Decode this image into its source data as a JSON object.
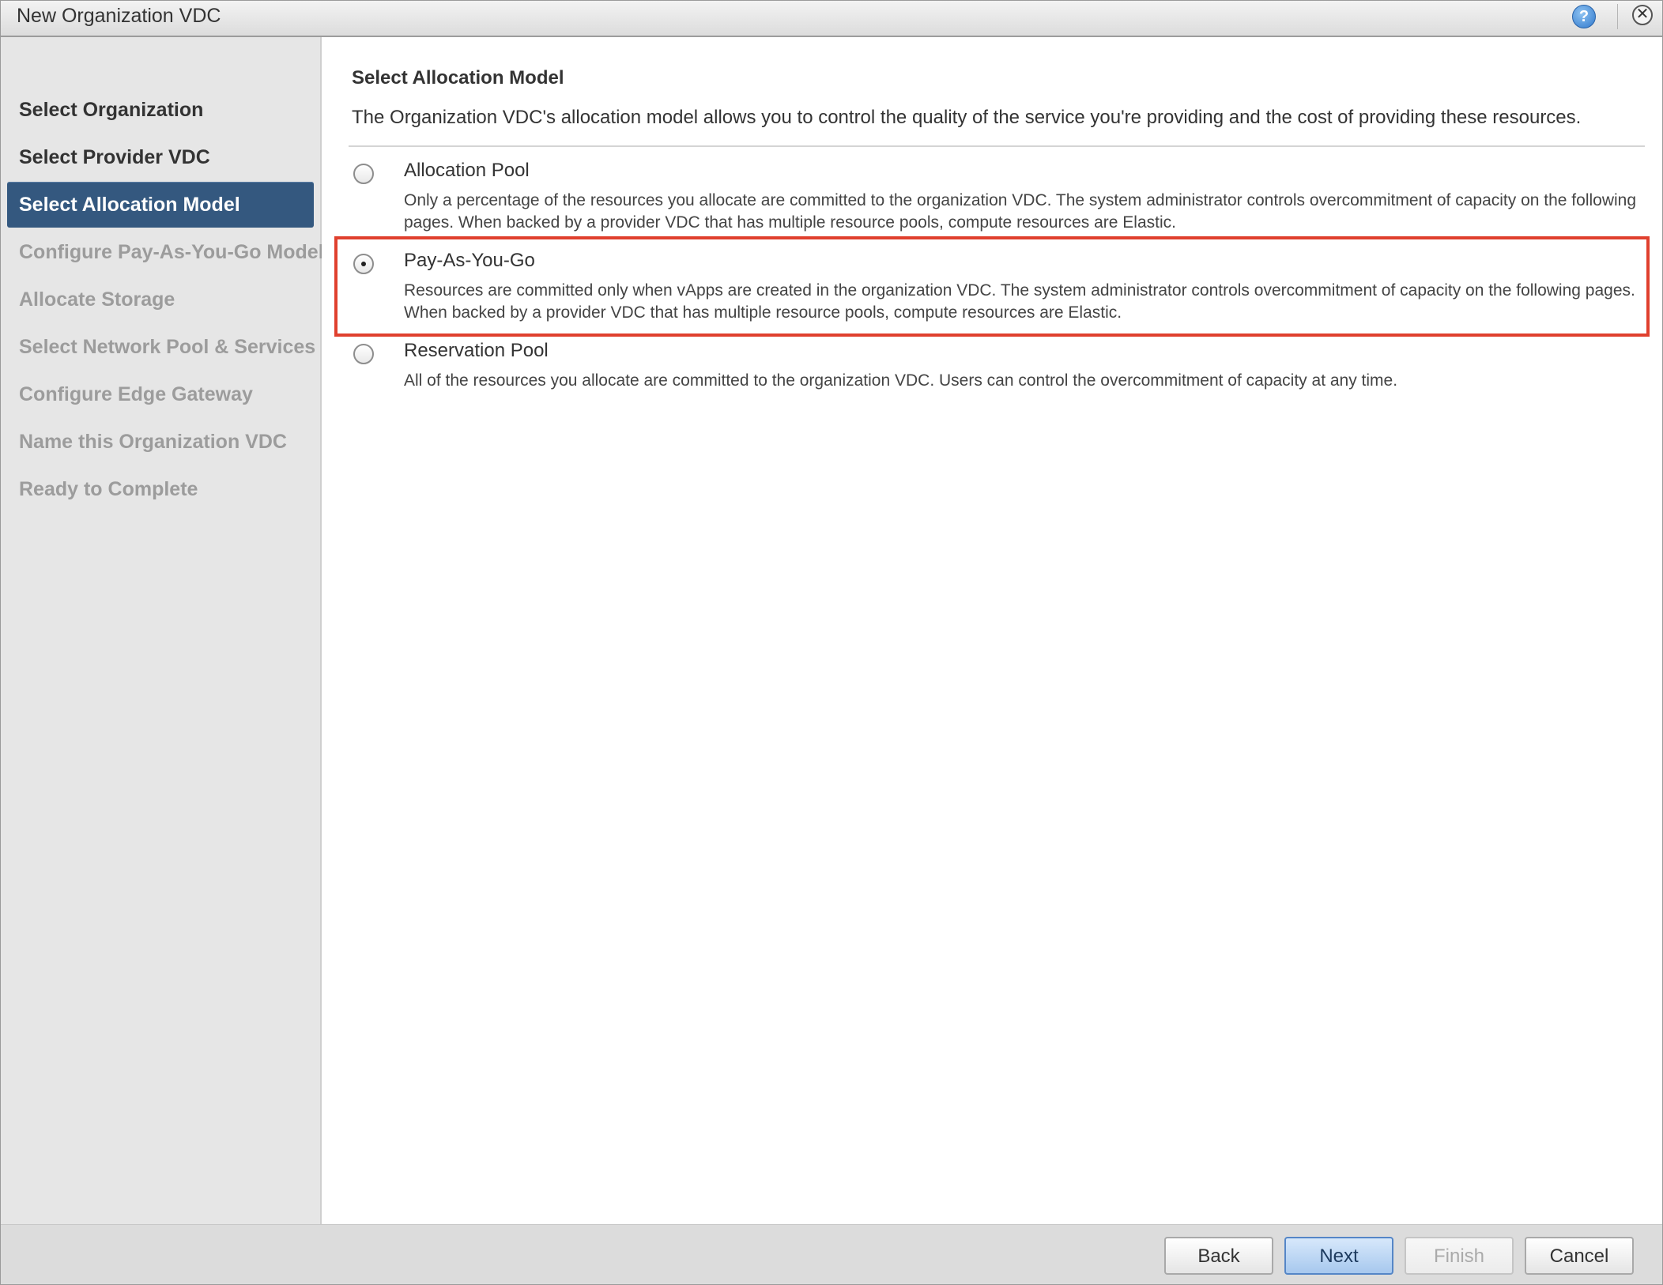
{
  "window": {
    "title": "New Organization VDC",
    "help_icon": "help-icon",
    "help_glyph": "?",
    "close_icon": "close-icon",
    "close_glyph": "✕"
  },
  "sidebar": {
    "active_index": 2,
    "items": [
      {
        "label": "Select Organization",
        "state": "done"
      },
      {
        "label": "Select Provider VDC",
        "state": "done"
      },
      {
        "label": "Select Allocation Model",
        "state": "active"
      },
      {
        "label": "Configure Pay-As-You-Go Model",
        "state": "pending"
      },
      {
        "label": "Allocate Storage",
        "state": "pending"
      },
      {
        "label": "Select Network Pool & Services",
        "state": "pending"
      },
      {
        "label": "Configure Edge Gateway",
        "state": "pending"
      },
      {
        "label": "Name this Organization VDC",
        "state": "pending"
      },
      {
        "label": "Ready to Complete",
        "state": "pending"
      }
    ]
  },
  "main": {
    "title": "Select Allocation Model",
    "description": "The Organization VDC's allocation model allows you to control the quality of the service you're providing and the cost of providing these resources.",
    "selected_option": "Pay-As-You-Go",
    "options": [
      {
        "label": "Allocation Pool",
        "description": "Only a percentage of the resources you allocate are committed to the organization VDC. The system administrator controls overcommitment of capacity on the following pages. When backed by a provider VDC that has multiple resource pools, compute resources are Elastic.",
        "selected": false
      },
      {
        "label": "Pay-As-You-Go",
        "description": "Resources are committed only when vApps are created in the organization VDC. The system administrator controls overcommitment of capacity on the following pages. When backed by a provider VDC that has multiple resource pools, compute resources are Elastic.",
        "selected": true
      },
      {
        "label": "Reservation Pool",
        "description": "All of the resources you allocate are committed to the organization VDC. Users can control the overcommitment of capacity at any time.",
        "selected": false
      }
    ],
    "highlight_color": "#e0402e"
  },
  "footer": {
    "back_label": "Back",
    "next_label": "Next",
    "finish_label": "Finish",
    "cancel_label": "Cancel",
    "finish_enabled": false
  },
  "colors": {
    "active_step_bg": "#34587f",
    "pending_step_text": "#9c9c9c",
    "primary_button": "#a7c8ee"
  }
}
